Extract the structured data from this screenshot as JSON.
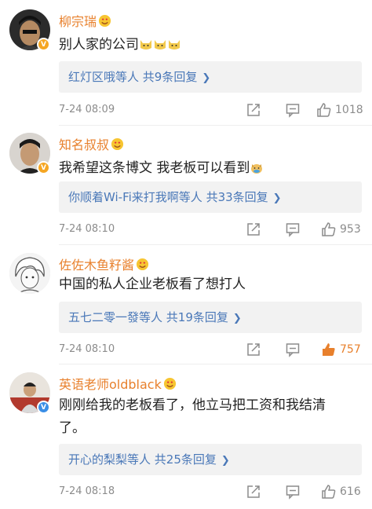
{
  "comments": [
    {
      "username": "柳宗瑞",
      "text": "别人家的公司",
      "emojis": [
        "cat-face-icon",
        "cat-face-icon",
        "cat-face-icon"
      ],
      "reply_preview": "红灯区哦等人",
      "reply_count": "共9条回复",
      "time": "7-24 08:09",
      "likes": "1018",
      "liked": false,
      "badge_color": "#f5a623"
    },
    {
      "username": "知名叔叔",
      "text": "我希望这条博文 我老板可以看到",
      "emojis": [
        "doge-icon"
      ],
      "reply_preview": "你顺着Wi-Fi来打我啊等人",
      "reply_count": "共33条回复",
      "time": "7-24 08:10",
      "likes": "953",
      "liked": false,
      "badge_color": "#f5a623"
    },
    {
      "username": "佐佐木鱼籽酱",
      "text": "中国的私人企业老板看了想打人",
      "emojis": [],
      "reply_preview": "五七二零一發等人",
      "reply_count": "共19条回复",
      "time": "7-24 08:10",
      "likes": "757",
      "liked": true,
      "badge_color": ""
    },
    {
      "username": "英语老师oldblack",
      "text": "刚刚给我的老板看了，他立马把工资和我结清了。",
      "emojis": [],
      "reply_preview": "开心的梨梨等人",
      "reply_count": "共25条回复",
      "time": "7-24 08:18",
      "likes": "616",
      "liked": false,
      "badge_color": "#3a8ee6"
    }
  ],
  "colors": {
    "username": "#e8802c",
    "reply_link": "#4a78b8",
    "meta_gray": "#8c8c8c",
    "liked": "#e8802c"
  }
}
